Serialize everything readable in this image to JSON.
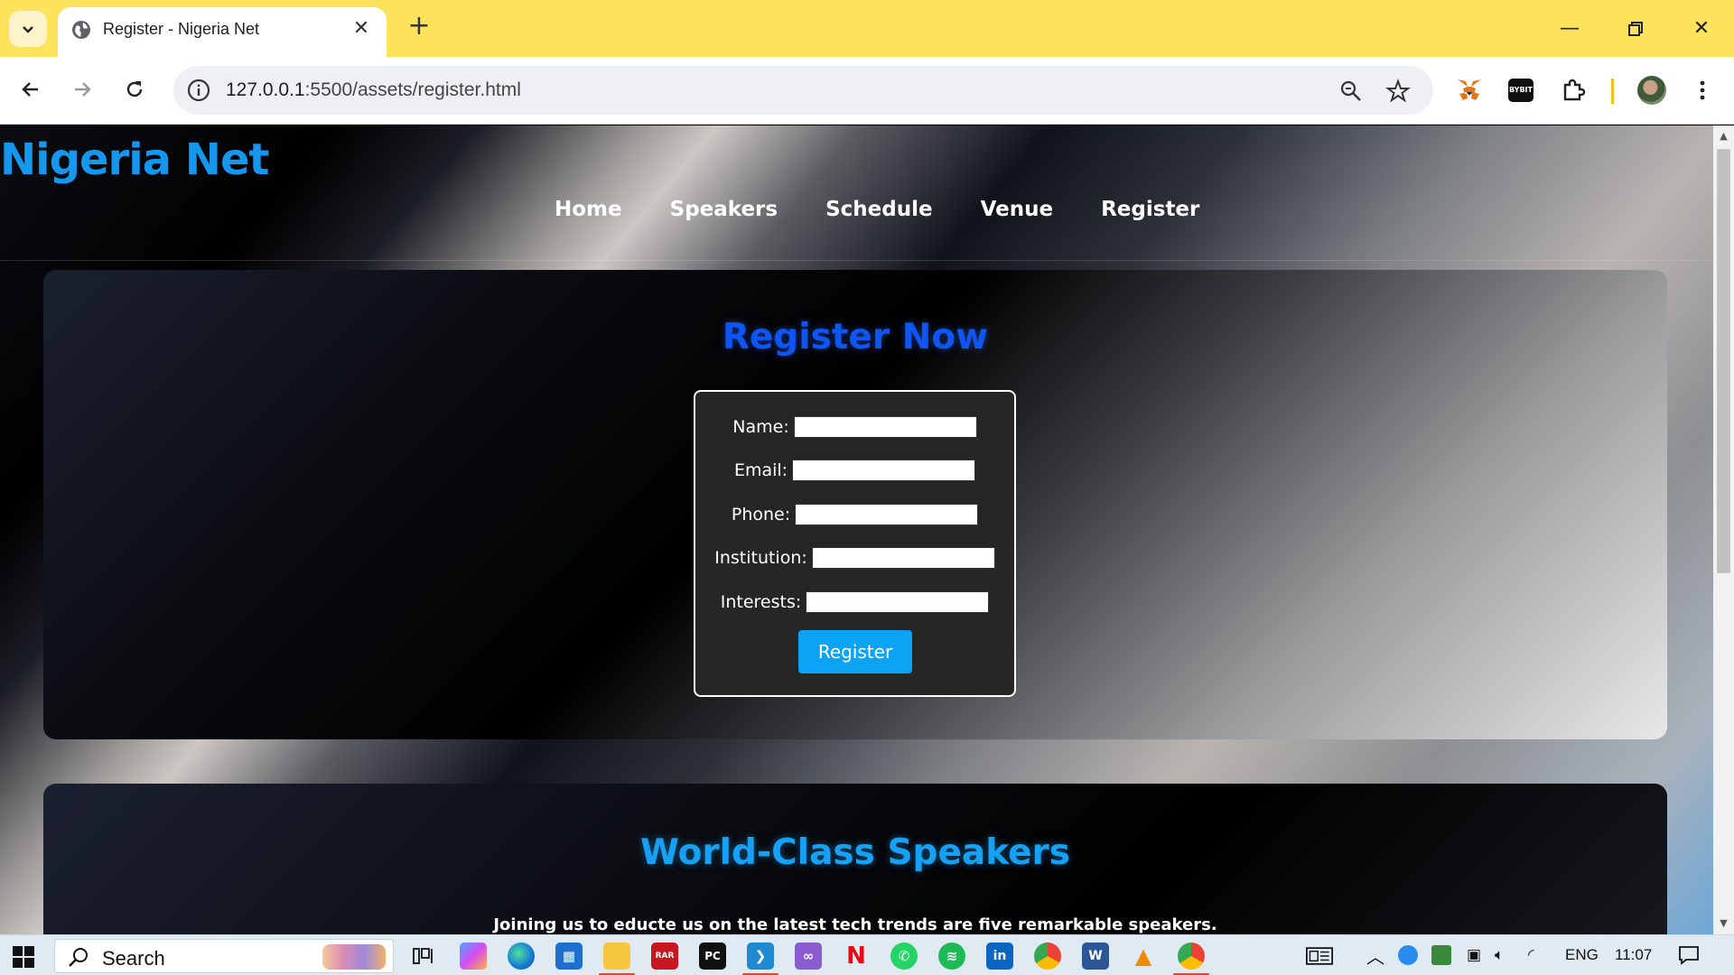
{
  "browser": {
    "tab_title": "Register - Nigeria Net",
    "url_host": "127.0.0.1",
    "url_rest": ":5500/assets/register.html"
  },
  "site": {
    "logo": "Nigeria Net",
    "nav": [
      "Home",
      "Speakers",
      "Schedule",
      "Venue",
      "Register"
    ]
  },
  "register": {
    "title": "Register Now",
    "fields": [
      {
        "label": "Name:"
      },
      {
        "label": "Email:"
      },
      {
        "label": "Phone:"
      },
      {
        "label": "Institution:"
      },
      {
        "label": "Interests:"
      }
    ],
    "submit_label": "Register"
  },
  "speakers": {
    "title": "World-Class Speakers",
    "subtitle": "Joining us to educte us on the latest tech trends are five remarkable speakers."
  },
  "taskbar": {
    "search_label": "Search",
    "language": "ENG",
    "time": "11:07"
  },
  "colors": {
    "chrome_frame": "#fde35c",
    "logo": "#1597ee",
    "register_title": "#0e55f1",
    "speakers_title": "#17a1f4",
    "register_button": "#0ba3f4"
  }
}
